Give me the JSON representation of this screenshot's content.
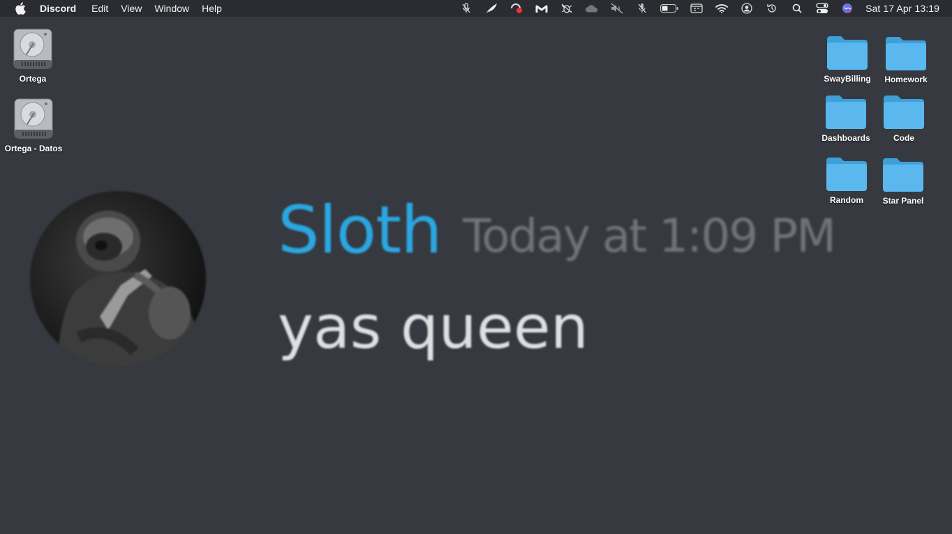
{
  "menubar": {
    "app_name": "Discord",
    "menus": [
      "Edit",
      "View",
      "Window",
      "Help"
    ],
    "tray_icons": [
      "mic-muted-icon",
      "feather-icon",
      "screen-record-icon",
      "malwarebytes-icon",
      "bug-icon",
      "cloud-icon",
      "speaker-muted-icon",
      "mic-off-icon",
      "battery-icon",
      "calendar-card-icon",
      "wifi-icon",
      "user-circle-icon",
      "time-machine-icon",
      "search-icon",
      "control-center-icon",
      "siri-icon"
    ],
    "clock": "Sat 17 Apr  13:19"
  },
  "desktop": {
    "disks": [
      {
        "label": "Ortega"
      },
      {
        "label": "Ortega - Datos"
      }
    ],
    "folders": [
      {
        "label": "SwayBilling"
      },
      {
        "label": "Homework"
      },
      {
        "label": "Dashboards"
      },
      {
        "label": "Code"
      },
      {
        "label": "Random"
      },
      {
        "label": "Star Panel"
      }
    ]
  },
  "message": {
    "username": "Sloth",
    "timestamp": "Today at 1:09 PM",
    "text": "yas queen",
    "username_color": "#2aa7e0"
  },
  "colors": {
    "background": "#363940",
    "folder": "#5ab8ef"
  }
}
